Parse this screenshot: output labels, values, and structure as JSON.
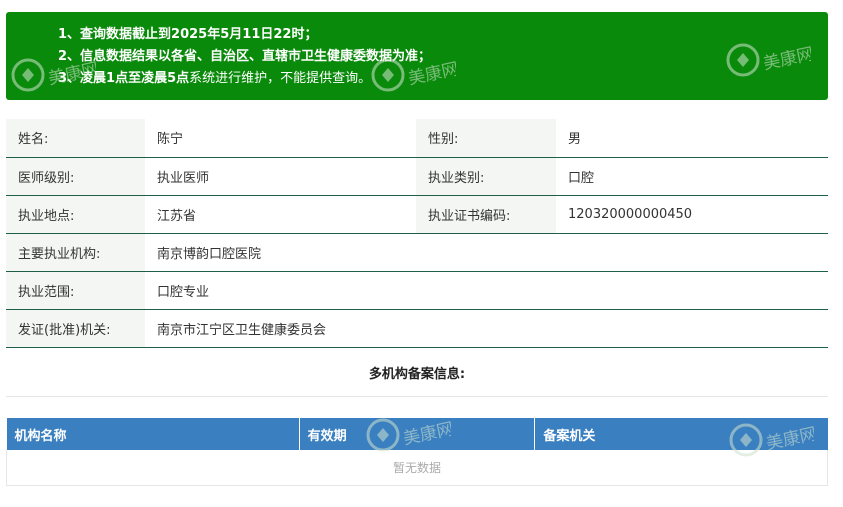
{
  "notice": {
    "lines": [
      {
        "bold": "1、查询数据截止到2025年5月11日22时；",
        "rest": ""
      },
      {
        "bold": "2、信息数据结果以各省、自治区、直辖市卫生健康委数据为准；",
        "rest": ""
      },
      {
        "bold": "3、凌晨1点至凌晨5点",
        "rest": "系统进行维护，不能提供查询。"
      }
    ]
  },
  "info": {
    "name_label": "姓名:",
    "name_value": "陈宁",
    "gender_label": "性别:",
    "gender_value": "男",
    "level_label": "医师级别:",
    "level_value": "执业医师",
    "category_label": "执业类别:",
    "category_value": "口腔",
    "location_label": "执业地点:",
    "location_value": "江苏省",
    "cert_label": "执业证书编码:",
    "cert_value": "120320000000450",
    "institution_label": "主要执业机构:",
    "institution_value": "南京博韵口腔医院",
    "scope_label": "执业范围:",
    "scope_value": "口腔专业",
    "issuer_label": "发证(批准)机关:",
    "issuer_value": "南京市江宁区卫生健康委员会"
  },
  "multi": {
    "title": "多机构备案信息:",
    "columns": [
      "机构名称",
      "有效期",
      "备案机关"
    ],
    "empty_text": "暂无数据"
  },
  "watermark": {
    "text": "美康网",
    "color": "#cfe3cf"
  }
}
